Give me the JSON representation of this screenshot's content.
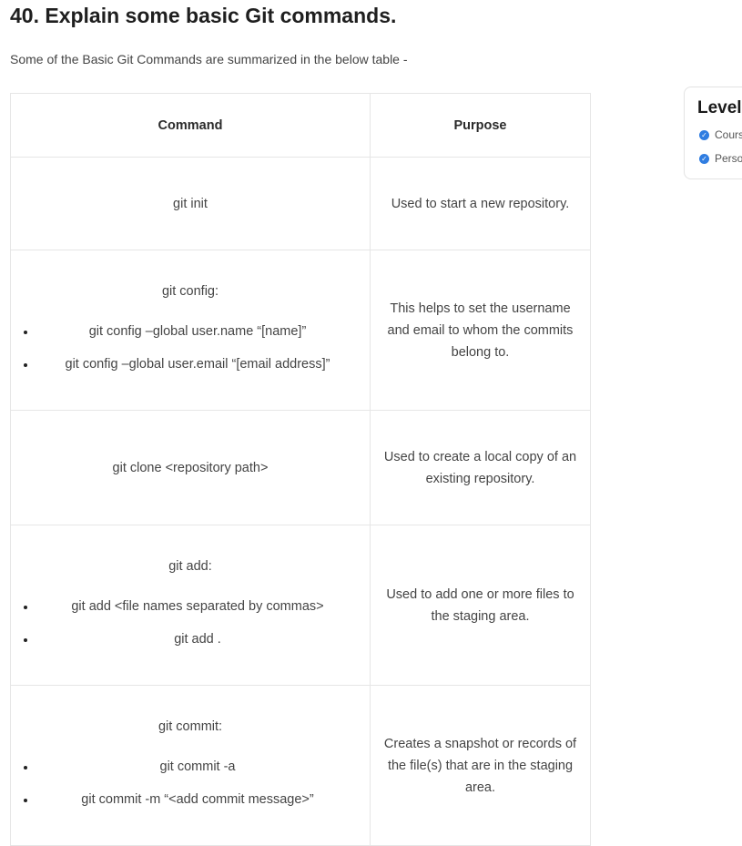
{
  "heading": "40. Explain some basic Git commands.",
  "intro": "Some of the Basic Git Commands are summarized in the below table -",
  "table": {
    "headers": [
      "Command",
      "Purpose"
    ],
    "rows": [
      {
        "command": "git init",
        "sub": [],
        "purpose": "Used to start a new repository."
      },
      {
        "command": "git config:",
        "sub": [
          "git config –global user.name “[name]”",
          "git config –global user.email “[email address]”"
        ],
        "purpose": "This helps to set the username and email to whom the commits belong to."
      },
      {
        "command": "git clone <repository path>",
        "sub": [],
        "purpose": "Used to create a local copy of an existing repository."
      },
      {
        "command": "git add:",
        "sub": [
          "git add <file names separated by commas>",
          "git add ."
        ],
        "purpose": "Used to add one or more files to the staging area."
      },
      {
        "command": "git commit:",
        "sub": [
          "git commit -a",
          "git commit -m “<add commit message>”"
        ],
        "purpose": "Creates a snapshot or records of the file(s) that are in the staging area."
      }
    ]
  },
  "side_card": {
    "title": "Level-",
    "items": [
      "Cours",
      "Perso"
    ],
    "accent": "#2f7de1"
  }
}
